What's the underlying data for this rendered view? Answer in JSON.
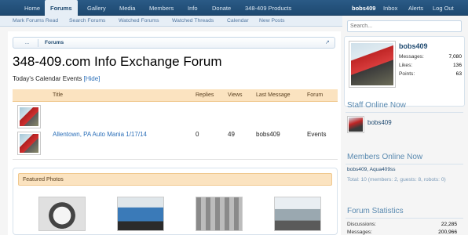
{
  "topnav": {
    "items": [
      "Home",
      "Forums",
      "Gallery",
      "Media",
      "Members",
      "Info",
      "Donate",
      "348-409 Products"
    ],
    "right": [
      "bobs409",
      "Inbox",
      "Alerts",
      "Log Out"
    ]
  },
  "subnav": {
    "items": [
      "Mark Forums Read",
      "Search Forums",
      "Watched Forums",
      "Watched Threads",
      "Calendar",
      "New Posts"
    ]
  },
  "breadcrumb": {
    "home": "...",
    "current": "Forums"
  },
  "page": {
    "title": "348-409.com Info Exchange Forum",
    "events_label": "Today's Calendar Events",
    "hide_link": "[Hide]"
  },
  "events_table": {
    "headers": [
      "Title",
      "Replies",
      "Views",
      "Last Message",
      "Forum"
    ],
    "rows": [
      {
        "title": "Allentown, PA Auto Mania 1/17/14",
        "replies": "0",
        "views": "49",
        "last_message": "bobs409",
        "forum": "Events"
      }
    ]
  },
  "featured": {
    "heading": "Featured Photos"
  },
  "sidebar": {
    "search_placeholder": "Search...",
    "profile": {
      "name": "bobs409",
      "stats": [
        {
          "label": "Messages:",
          "value": "7,080"
        },
        {
          "label": "Likes:",
          "value": "136"
        },
        {
          "label": "Points:",
          "value": "63"
        }
      ]
    },
    "staff_online": {
      "heading": "Staff Online Now",
      "member": "bobs409"
    },
    "members_online": {
      "heading": "Members Online Now",
      "list": "bobs409, Aqua409ss",
      "total": "Total: 10 (members: 2, guests: 8, robots: 0)"
    },
    "forum_stats": {
      "heading": "Forum Statistics",
      "stats": [
        {
          "label": "Discussions:",
          "value": "22,285"
        },
        {
          "label": "Messages:",
          "value": "200,966"
        }
      ]
    }
  }
}
